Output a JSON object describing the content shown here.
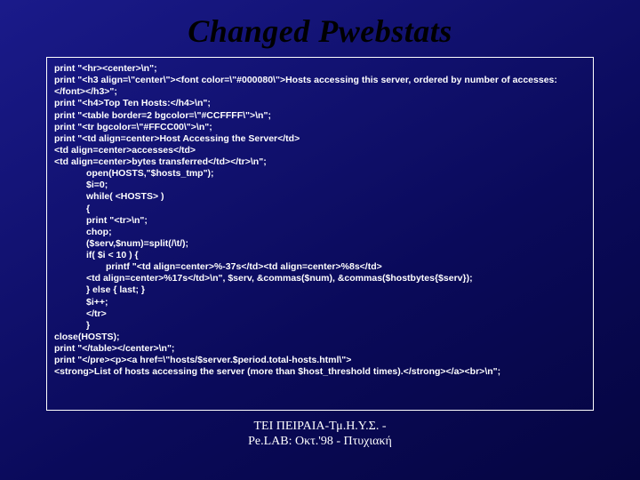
{
  "title": "Changed Pwebstats",
  "code": {
    "l01": "print \"<hr><center>\\n\";",
    "l02": "print \"<h3 align=\\\"center\\\"><font color=\\\"#000080\\\">Hosts accessing this server, ordered by number of accesses:</font></h3>\";",
    "l03": "print \"<h4>Top Ten Hosts:</h4>\\n\";",
    "l04": "print \"<table border=2 bgcolor=\\\"#CCFFFF\\\">\\n\";",
    "l05": "print \"<tr bgcolor=\\\"#FFCC00\\\">\\n\";",
    "l06": "print \"<td align=center>Host Accessing the Server</td>",
    "l07": "<td align=center>accesses</td>",
    "l08": "<td align=center>bytes transferred</td></tr>\\n\";",
    "l09": "open(HOSTS,\"$hosts_tmp\");",
    "l10": "$i=0;",
    "l11": "while( <HOSTS> )",
    "l12": "{",
    "l13": "print \"<tr>\\n\";",
    "l14": "chop;",
    "l15": "($serv,$num)=split(/\\t/);",
    "l16": "if( $i < 10 ) {",
    "l17": "printf \"<td align=center>%-37s</td><td align=center>%8s</td>",
    "l18": "<td align=center>%17s</td>\\n\",  $serv,  &commas($num),  &commas($hostbytes{$serv});",
    "l19": "} else { last; }",
    "l20": "$i++;",
    "l21": "</tr>",
    "l22": "}",
    "l23": "close(HOSTS);",
    "l24": " print \"</table></center>\\n\";",
    "l25": "print \"</pre><p><a href=\\\"hosts/$server.$period.total-hosts.html\\\">",
    "l26": "<strong>List of hosts accessing the server (more than $host_threshold times).</strong></a><br>\\n\";"
  },
  "footer": {
    "line1": "ΤΕΙ ΠΕΙΡΑΙΑ-Τμ.Η.Υ.Σ. -",
    "line2": "Pe.LAB: Οκτ.'98      -      Πτυχιακή"
  }
}
